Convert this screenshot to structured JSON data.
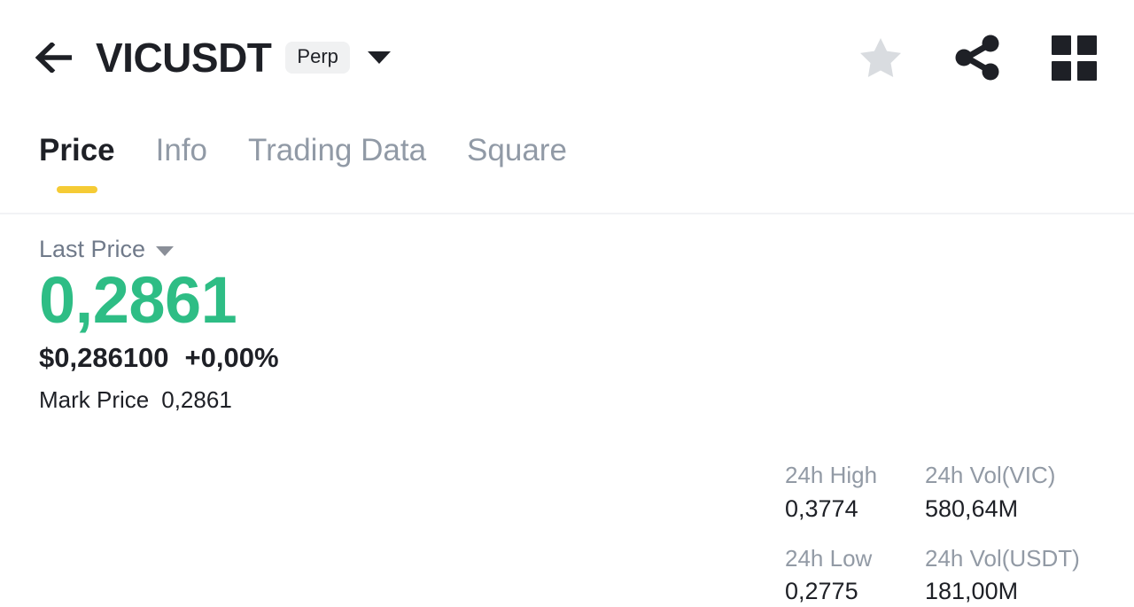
{
  "header": {
    "back_icon": "arrow-left-icon",
    "symbol": "VICUSDT",
    "contract_badge": "Perp",
    "dropdown_icon": "caret-down-icon",
    "favorite_icon": "star-icon",
    "share_icon": "share-icon",
    "grid_icon": "grid-icon"
  },
  "tabs": [
    {
      "label": "Price",
      "active": true
    },
    {
      "label": "Info",
      "active": false
    },
    {
      "label": "Trading Data",
      "active": false
    },
    {
      "label": "Square",
      "active": false
    }
  ],
  "price": {
    "last_price_label": "Last Price",
    "last_price_caret": "caret-down-icon",
    "last_price_value": "0,2861",
    "fiat_price": "$0,286100",
    "change_percent": "+0,00%",
    "mark_price_label": "Mark Price",
    "mark_price_value": "0,2861"
  },
  "stats": [
    {
      "label": "24h High",
      "value": "0,3774"
    },
    {
      "label": "24h Vol(VIC)",
      "value": "580,64M"
    },
    {
      "label": "24h Low",
      "value": "0,2775"
    },
    {
      "label": "24h Vol(USDT)",
      "value": "181,00M"
    }
  ],
  "colors": {
    "up_green": "#2EBD85",
    "accent_yellow": "#F5CB35",
    "text_primary": "#1E2026",
    "text_secondary": "#929AA5",
    "badge_bg": "#F0F1F2",
    "star_gray": "#D9DCE0"
  }
}
